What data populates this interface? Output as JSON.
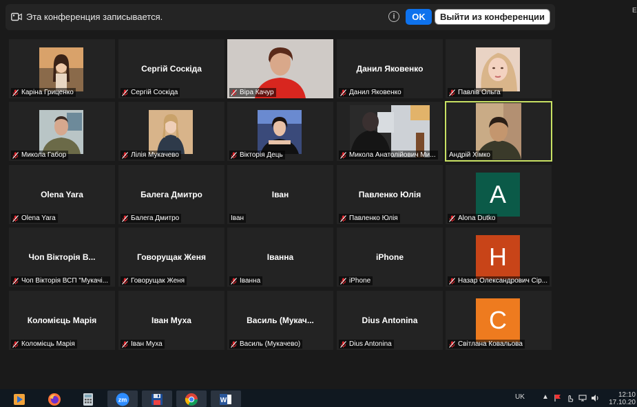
{
  "banner": {
    "recording_text": "Эта конференция записывается.",
    "info_glyph": "i",
    "ok_label": "OK",
    "leave_label": "Выйти из конференции"
  },
  "top_right_text": "E",
  "colors": {
    "active_border": "#c8e163",
    "mute_icon": "#e0242c",
    "avatar_a": "#0b5a48",
    "avatar_h": "#c84418",
    "avatar_c": "#ee7b1f"
  },
  "participants": [
    {
      "label": "Каріна Гриценко",
      "big_name": "",
      "muted": true,
      "view": "photo-girl-street"
    },
    {
      "label": "Сергій Соскіда",
      "big_name": "Сергій Соскіда",
      "muted": true,
      "view": "name"
    },
    {
      "label": "Віра Качур",
      "big_name": "",
      "muted": true,
      "view": "video-woman-red"
    },
    {
      "label": "Данил Яковенко",
      "big_name": "Данил Яковенко",
      "muted": true,
      "view": "name"
    },
    {
      "label": "Павлів Ольга",
      "big_name": "",
      "muted": true,
      "view": "photo-girl-blonde"
    },
    {
      "label": "Микола Габор",
      "big_name": "",
      "muted": true,
      "view": "photo-man-uniform"
    },
    {
      "label": "Лілія Мукачево",
      "big_name": "",
      "muted": true,
      "view": "photo-woman-coat"
    },
    {
      "label": "Вікторія Дець",
      "big_name": "",
      "muted": true,
      "view": "photo-girl-dark"
    },
    {
      "label": "Микола Анатолійович Ми...",
      "big_name": "",
      "muted": true,
      "view": "video-room"
    },
    {
      "label": "Андрій Хімко",
      "big_name": "",
      "muted": false,
      "view": "video-boy",
      "active": true
    },
    {
      "label": "Olena Yara",
      "big_name": "Olena Yara",
      "muted": true,
      "view": "name"
    },
    {
      "label": "Балега Дмитро",
      "big_name": "Балега Дмитро",
      "muted": true,
      "view": "name"
    },
    {
      "label": "Іван",
      "big_name": "Іван",
      "muted": false,
      "view": "name"
    },
    {
      "label": "Павленко Юлія",
      "big_name": "Павленко Юлія",
      "muted": true,
      "view": "name"
    },
    {
      "label": "Alona Dutko",
      "big_name": "",
      "muted": true,
      "view": "avatar",
      "avatar_letter": "A",
      "avatar_color": "#0b5a48"
    },
    {
      "label": "Чоп Вікторія ВСП \"Мукачі...",
      "big_name": "Чоп Вікторія В...",
      "muted": true,
      "view": "name"
    },
    {
      "label": "Говорущак Женя",
      "big_name": "Говорущак Женя",
      "muted": true,
      "view": "name"
    },
    {
      "label": "Іванна",
      "big_name": "Іванна",
      "muted": true,
      "view": "name"
    },
    {
      "label": "iPhone",
      "big_name": "iPhone",
      "muted": true,
      "view": "name"
    },
    {
      "label": "Назар Олександрович Сір...",
      "big_name": "",
      "muted": true,
      "view": "avatar",
      "avatar_letter": "H",
      "avatar_color": "#c84418"
    },
    {
      "label": "Коломієць Марія",
      "big_name": "Коломієць Марія",
      "muted": true,
      "view": "name"
    },
    {
      "label": "Іван Муха",
      "big_name": "Іван Муха",
      "muted": true,
      "view": "name"
    },
    {
      "label": "Василь (Мукачево)",
      "big_name": "Василь  (Мукач...",
      "muted": true,
      "view": "name"
    },
    {
      "label": "Dius Antonina",
      "big_name": "Dius Antonina",
      "muted": true,
      "view": "name"
    },
    {
      "label": "Світлана Ковальова",
      "big_name": "",
      "muted": true,
      "view": "avatar",
      "avatar_letter": "C",
      "avatar_color": "#ee7b1f"
    }
  ],
  "taskbar": {
    "apps": [
      {
        "name": "media-player-icon",
        "open": false
      },
      {
        "name": "firefox-icon",
        "open": false
      },
      {
        "name": "calculator-icon",
        "open": false
      },
      {
        "name": "zoom-icon",
        "open": true,
        "text": "zm"
      },
      {
        "name": "save-disk-icon",
        "open": true
      },
      {
        "name": "chrome-icon",
        "open": true
      },
      {
        "name": "word-icon",
        "open": true,
        "text": "W"
      }
    ],
    "language": "UK",
    "time": "12:10",
    "date": "17.10.20"
  }
}
